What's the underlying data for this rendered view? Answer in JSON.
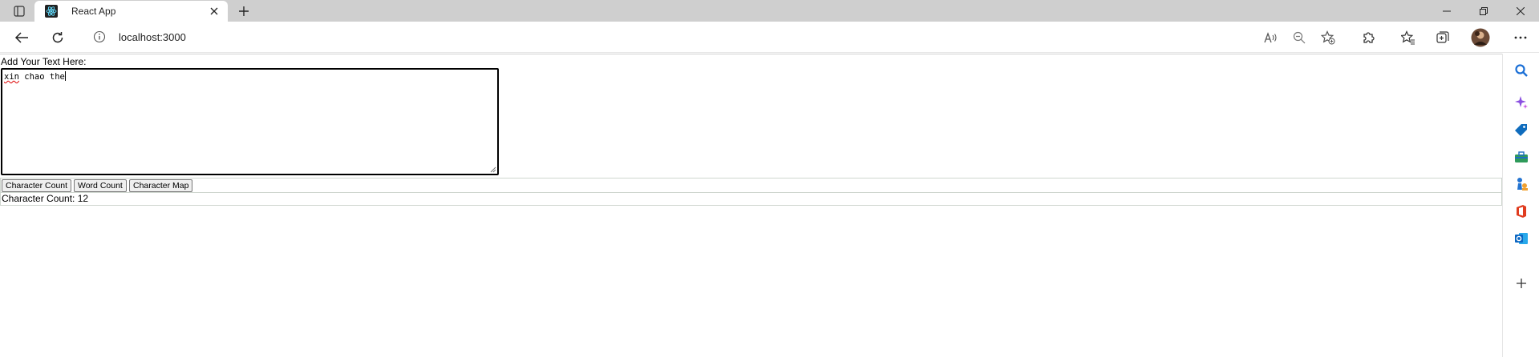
{
  "browser": {
    "tab": {
      "title": "React App"
    },
    "address": {
      "url": "localhost:3000"
    }
  },
  "app": {
    "input_label": "Add Your Text Here:",
    "text_value_misspelled": "xin",
    "text_value_rest": " chao the",
    "buttons": {
      "character_count": "Character Count",
      "word_count": "Word Count",
      "character_map": "Character Map"
    },
    "result_text": "Character Count: 12"
  },
  "colors": {
    "react": "#61dafb",
    "search": "#1a6fd6",
    "copilot": "#8a4fe0",
    "shopping": "#0f6cbd",
    "tools": "#2e9a5a",
    "games": "#2474d1",
    "office": "#e03c1f",
    "outlook": "#0a66c2"
  }
}
